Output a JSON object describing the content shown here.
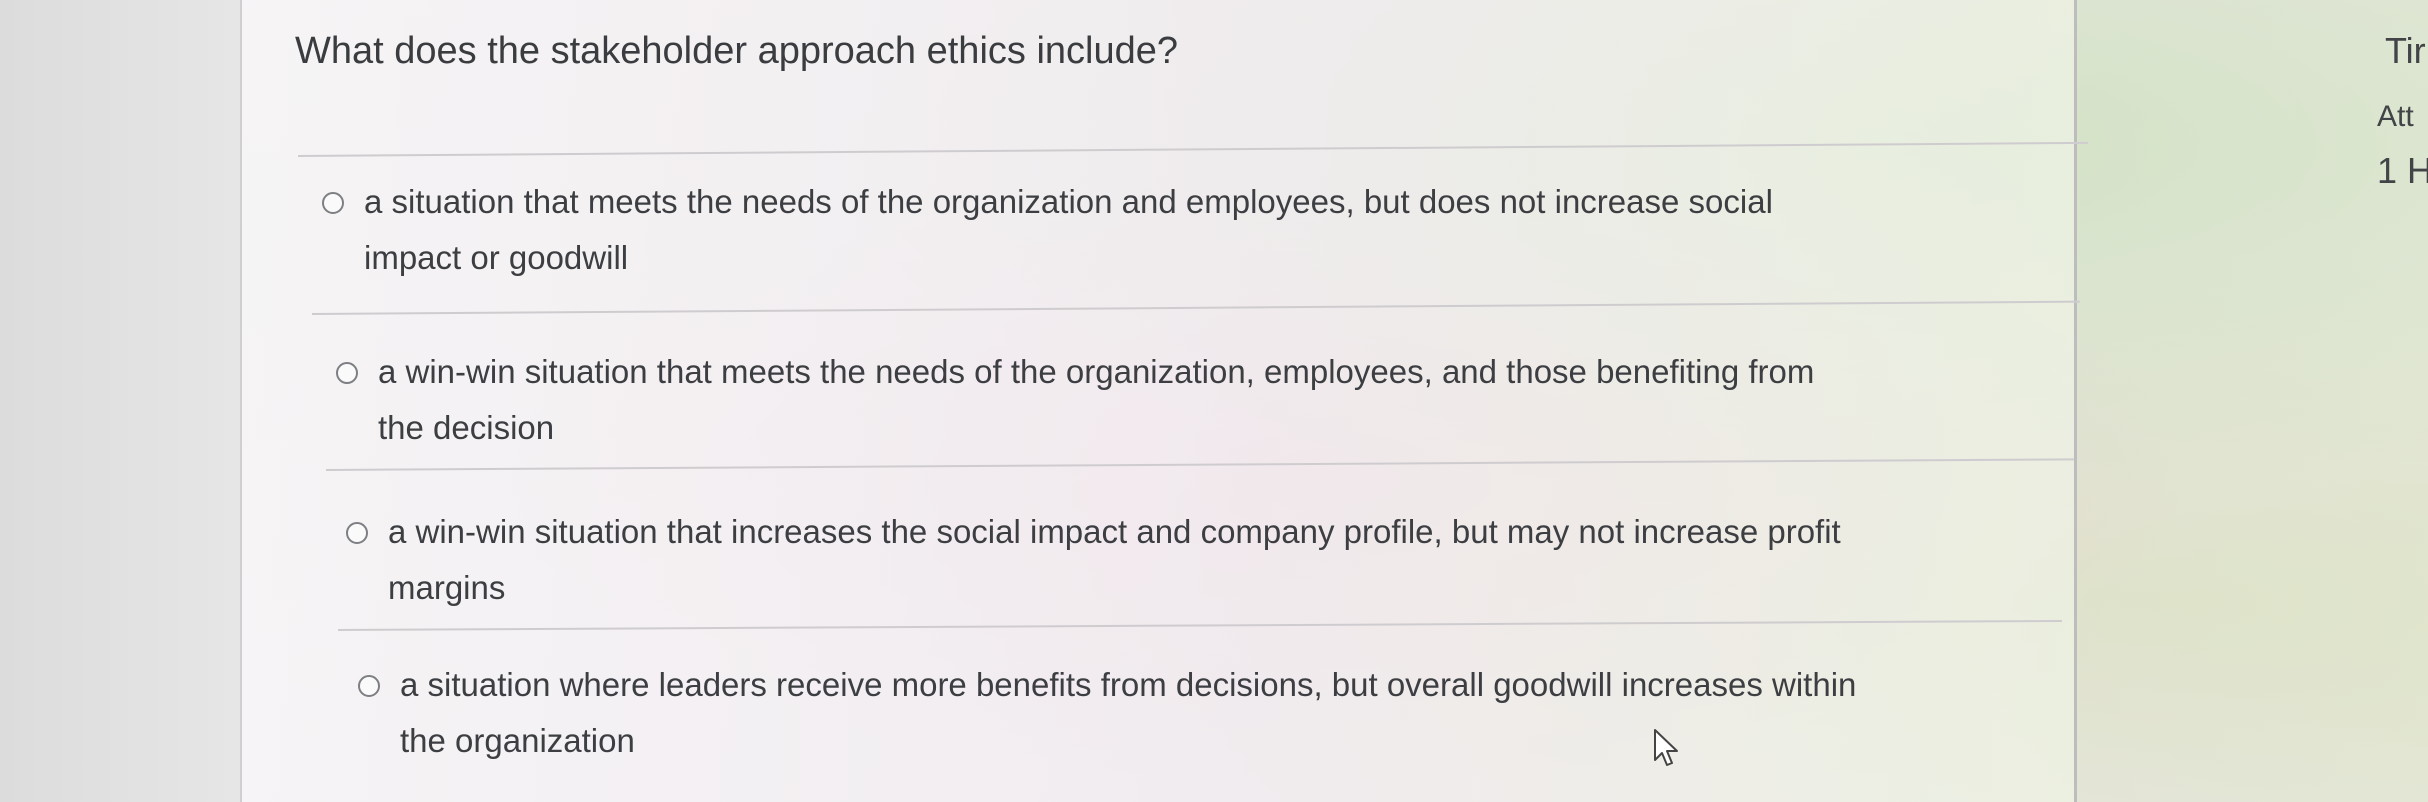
{
  "question": {
    "text": "What does the stakeholder approach ethics include?"
  },
  "options": [
    {
      "line1": "a situation that meets the needs of the organization and employees, but does not increase social",
      "line2": "impact or goodwill",
      "selected": false
    },
    {
      "line1": "a win-win situation that meets the needs of the organization, employees, and those benefiting from",
      "line2": "the decision",
      "selected": false
    },
    {
      "line1": "a win-win situation that increases the social impact and company profile, but may not increase profit",
      "line2": "margins",
      "selected": false
    },
    {
      "line1": "a situation where leaders receive more benefits from decisions, but overall goodwill increases within",
      "line2": "the organization",
      "selected": false
    }
  ],
  "side_panel": {
    "line1": "Tir",
    "line2": "Att",
    "line3": "1 H"
  },
  "colors": {
    "text": "#3c3e42",
    "radio_border": "#7d7f83",
    "divider": "#cfcccf"
  }
}
